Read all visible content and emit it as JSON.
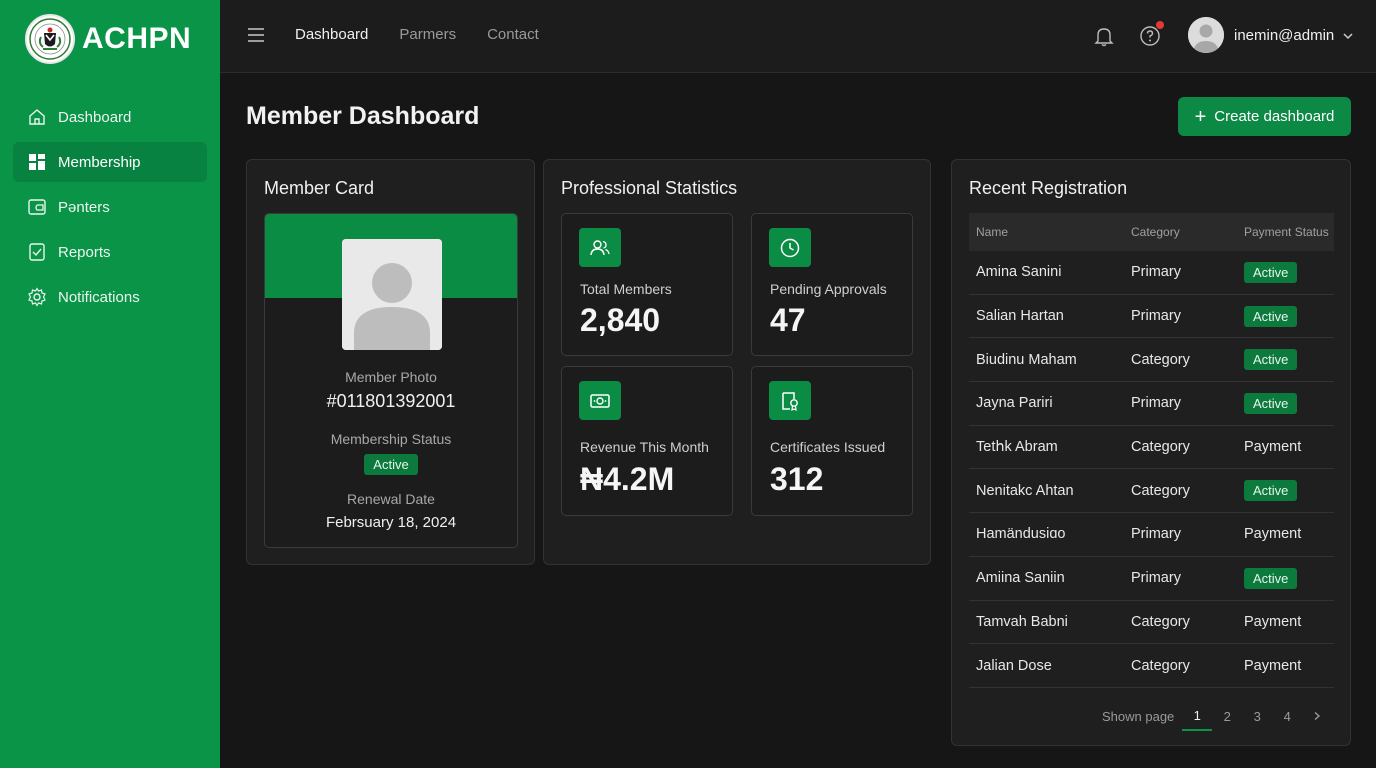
{
  "brand": {
    "name": "ACHPN"
  },
  "sidebar": {
    "items": [
      {
        "label": "Dashboard",
        "icon": "home-icon"
      },
      {
        "label": "Membership",
        "icon": "grid-icon"
      },
      {
        "label": "Pənters",
        "icon": "folder-icon"
      },
      {
        "label": "Reports",
        "icon": "report-icon"
      },
      {
        "label": "Notifications",
        "icon": "gear-icon"
      }
    ],
    "active_index": 1
  },
  "topbar": {
    "nav": [
      "Dashboard",
      "Parmers",
      "Contact"
    ],
    "user": "inemin@admin"
  },
  "main": {
    "title": "Member Dashboard",
    "create_label": "Create dashboard"
  },
  "member_card": {
    "title": "Member Card",
    "photo_label": "Member Photo",
    "member_id": "#011801392001",
    "status_label": "Membership Status",
    "status": "Active",
    "renewal_label": "Renewal Date",
    "renewal_date": "Febrsuary 18, 2024"
  },
  "stats": {
    "title": "Professional Statistics",
    "items": [
      {
        "label": "Total Members",
        "value": "2,840",
        "icon": "users-icon"
      },
      {
        "label": "Pending Approvals",
        "value": "47",
        "icon": "clock-icon"
      },
      {
        "label": "Revenue This Month",
        "value": "₦4.2M",
        "icon": "cash-icon"
      },
      {
        "label": "Certificates Issued",
        "value": "312",
        "icon": "certificate-icon"
      }
    ]
  },
  "registrations": {
    "title": "Recent Registration",
    "headers": [
      "Name",
      "Category",
      "Payment Status"
    ],
    "rows": [
      {
        "name": "Amina Sanini",
        "category": "Primary",
        "status": "Active"
      },
      {
        "name": "Salian Hartan",
        "category": "Primary",
        "status": "Active"
      },
      {
        "name": "Biudinu Maham",
        "category": "Category",
        "status": "Active"
      },
      {
        "name": "Jayna Pariri",
        "category": "Primary",
        "status": "Active"
      },
      {
        "name": "Tetհk Abram",
        "category": "Category",
        "status": "Payment"
      },
      {
        "name": "Nenitakc Ahtan",
        "category": "Category",
        "status": "Active"
      },
      {
        "name": "Hamändusiɑo",
        "category": "Primary",
        "status": "Payment"
      },
      {
        "name": "Amiina Saniin",
        "category": "Primary",
        "status": "Active"
      },
      {
        "name": "Tamvah Babni",
        "category": "Category",
        "status": "Payment"
      },
      {
        "name": "Jalian Dose",
        "category": "Category",
        "status": "Payment"
      }
    ],
    "pager": {
      "label": "Shown page",
      "pages": [
        "1",
        "2",
        "3",
        "4"
      ],
      "active": "1"
    }
  },
  "colors": {
    "brand_green": "#0a9447",
    "accent_green": "#0c8a45",
    "background": "#161616",
    "alert_dot": "#e53935"
  }
}
